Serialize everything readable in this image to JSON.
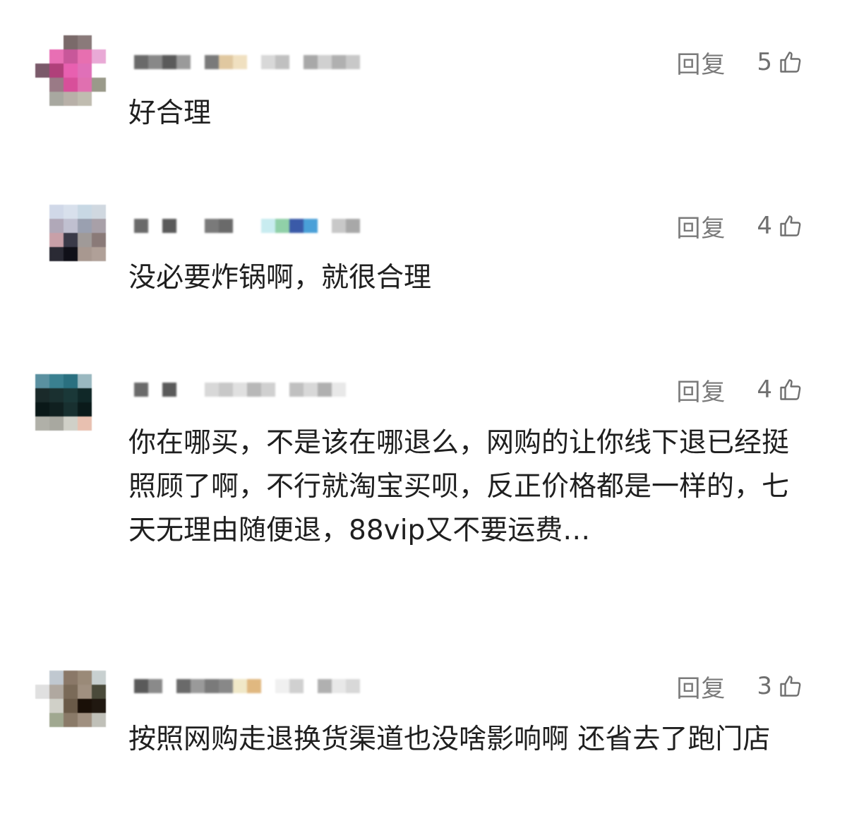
{
  "comments": [
    {
      "reply_label": "回复",
      "likes": "5",
      "text": "好合理",
      "avatar_colors": [
        "#ffffff",
        "#ffffff",
        "#7a6a6a",
        "#8a7a7a",
        "#ffffff",
        "#ffffff",
        "#e86fb4",
        "#c8579a",
        "#e76fb0",
        "#e9a9d6",
        "#7a5a6a",
        "#b0407a",
        "#e860b0",
        "#e070b8",
        "#ffffff",
        "#ffffff",
        "#9a7a86",
        "#d84f9a",
        "#e070b0",
        "#9a9a8a",
        "#ffffff",
        "#a8a8a0",
        "#b8b0a8",
        "#c0bcb0",
        "#ffffff"
      ],
      "name_colors": [
        "#6a6a6a",
        "#888888",
        "#5a5a5a",
        "#9a9a9a",
        "#ffffff",
        "#7a7a7a",
        "#e0c8a0",
        "#f0e0c0",
        "#ffffff",
        "#d8d8d8",
        "#c0c0c0",
        "#ffffff",
        "#a8a8a8",
        "#d0d0d0",
        "#b0b0b0",
        "#c8c8c8"
      ]
    },
    {
      "reply_label": "回复",
      "likes": "4",
      "text": "没必要炸锅啊，就很合理",
      "avatar_colors": [
        "#ffffff",
        "#d0d8e8",
        "#d8e0ec",
        "#c8d8e4",
        "#d0d8e0",
        "#ffffff",
        "#b0a8b8",
        "#c0c0d0",
        "#9aa0b0",
        "#a8a0a8",
        "#ffffff",
        "#c8a0a8",
        "#3a3a48",
        "#a09a98",
        "#8a7a78",
        "#ffffff",
        "#2a2a34",
        "#101018",
        "#a89890",
        "#b0a098",
        "#ffffff",
        "#ffffff",
        "#ffffff",
        "#ffffff",
        "#ffffff"
      ],
      "name_colors": [
        "#6a6a6a",
        "#ffffff",
        "#5a5a5a",
        "#ffffff",
        "#ffffff",
        "#7a7a7a",
        "#6a6a6a",
        "#ffffff",
        "#ffffff",
        "#c8ecf0",
        "#90d0a8",
        "#3a5aa8",
        "#4aa0d8",
        "#ffffff",
        "#c8c8c8",
        "#a8a8a8"
      ]
    },
    {
      "reply_label": "回复",
      "likes": "4",
      "text": "你在哪买，不是该在哪退么，网购的让你线下退已经挺照顾了啊，不行就淘宝买呗，反正价格都是一样的，七天无理由随便退，88vip又不要运费…",
      "avatar_colors": [
        "#ffffff",
        "#ffffff",
        "#ffffff",
        "#ffffff",
        "#ffffff",
        "#5a90a0",
        "#3a8090",
        "#2a7080",
        "#9ab8c0",
        "#ffffff",
        "#1a2a2a",
        "#1a3030",
        "#1a3838",
        "#102828",
        "#ffffff",
        "#0a1818",
        "#102020",
        "#183030",
        "#0a1a1a",
        "#ffffff",
        "#b0b0a8",
        "#a8a8a0",
        "#d0d0c8",
        "#e8c0b0",
        "#ffffff"
      ],
      "name_colors": [
        "#6a6a6a",
        "#ffffff",
        "#5a5a5a",
        "#ffffff",
        "#ffffff",
        "#d8d8d8",
        "#c8c8c8",
        "#e0e0e0",
        "#b8b8b8",
        "#d0d0d0",
        "#ffffff",
        "#c0c0c0",
        "#d8d8d8",
        "#b0b0b0",
        "#e8e8e8",
        "#ffffff"
      ]
    },
    {
      "reply_label": "回复",
      "likes": "3",
      "text": "按照网购走退换货渠道也没啥影响啊 还省去了跑门店",
      "avatar_colors": [
        "#ffffff",
        "#ffffff",
        "#ffffff",
        "#ffffff",
        "#ffffff",
        "#ffffff",
        "#c0c8d0",
        "#8a7868",
        "#9a8a78",
        "#c8d0d0",
        "#e0e0e0",
        "#b0a8a0",
        "#7a6a58",
        "#a09080",
        "#4a4a3a",
        "#ffffff",
        "#d0d0c8",
        "#6a5a48",
        "#1a1008",
        "#201810",
        "#ffffff",
        "#a0a890",
        "#8a7a68",
        "#a09080",
        "#c0c0b8"
      ],
      "name_colors": [
        "#5a5a5a",
        "#8a8a8a",
        "#ffffff",
        "#6a6a6a",
        "#9a9a9a",
        "#7a7a7a",
        "#888888",
        "#f0e8c8",
        "#e0b880",
        "#ffffff",
        "#f0f0f0",
        "#d0d0d0",
        "#ffffff",
        "#b0b0b0",
        "#e8e8e8",
        "#d8d8d8"
      ]
    }
  ]
}
